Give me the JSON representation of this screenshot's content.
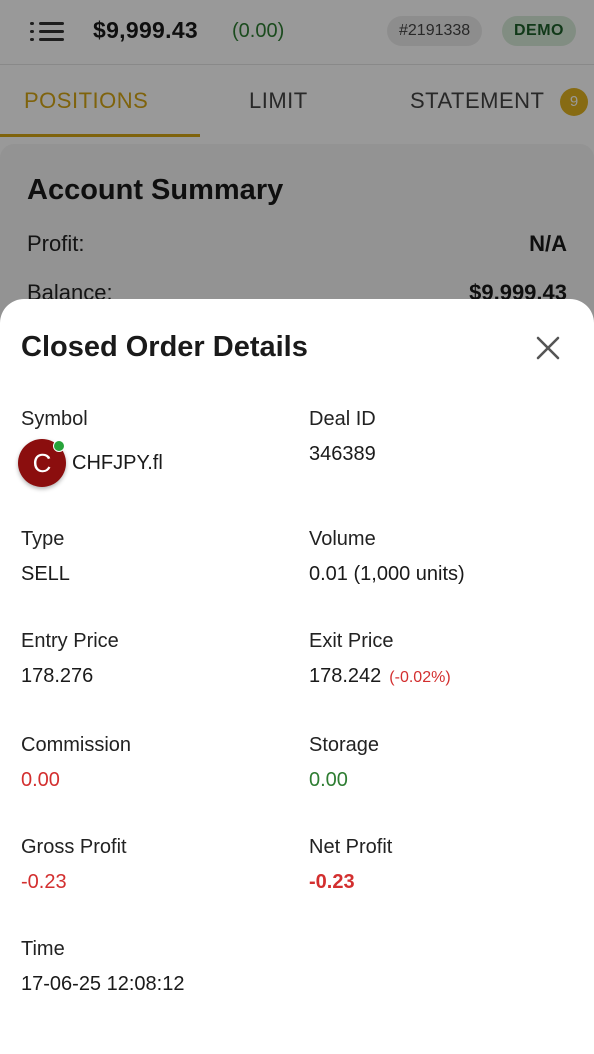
{
  "header": {
    "balance": "$9,999.43",
    "balance_change": "(0.00)",
    "account_id": "#2191338",
    "mode_badge": "DEMO"
  },
  "tabs": [
    {
      "label": "POSITIONS",
      "active": true
    },
    {
      "label": "LIMIT",
      "active": false
    },
    {
      "label": "STATEMENT",
      "active": false,
      "count": "9"
    }
  ],
  "summary": {
    "title": "Account Summary",
    "rows": [
      {
        "label": "Profit:",
        "value": "N/A"
      },
      {
        "label": "Balance:",
        "value": "$9,999.43"
      }
    ]
  },
  "order_details": {
    "title": "Closed Order Details",
    "symbol": {
      "label": "Symbol",
      "initial": "C",
      "value": "CHFJPY.fl"
    },
    "deal_id": {
      "label": "Deal ID",
      "value": "346389"
    },
    "type": {
      "label": "Type",
      "value": "SELL"
    },
    "volume": {
      "label": "Volume",
      "value": "0.01 (1,000 units)"
    },
    "entry_price": {
      "label": "Entry Price",
      "value": "178.276"
    },
    "exit_price": {
      "label": "Exit Price",
      "value": "178.242",
      "change": "(-0.02%)"
    },
    "commission": {
      "label": "Commission",
      "value": "0.00"
    },
    "storage": {
      "label": "Storage",
      "value": "0.00"
    },
    "gross_profit": {
      "label": "Gross Profit",
      "value": "-0.23"
    },
    "net_profit": {
      "label": "Net Profit",
      "value": "-0.23"
    },
    "time": {
      "label": "Time",
      "value": "17-06-25 12:08:12"
    }
  },
  "colors": {
    "accent": "#d4a514",
    "positive": "#2e7d32",
    "negative": "#d32f2f",
    "avatar": "#8b0e0e"
  },
  "icons": [
    "menu-icon",
    "close-icon",
    "online-status-icon"
  ]
}
